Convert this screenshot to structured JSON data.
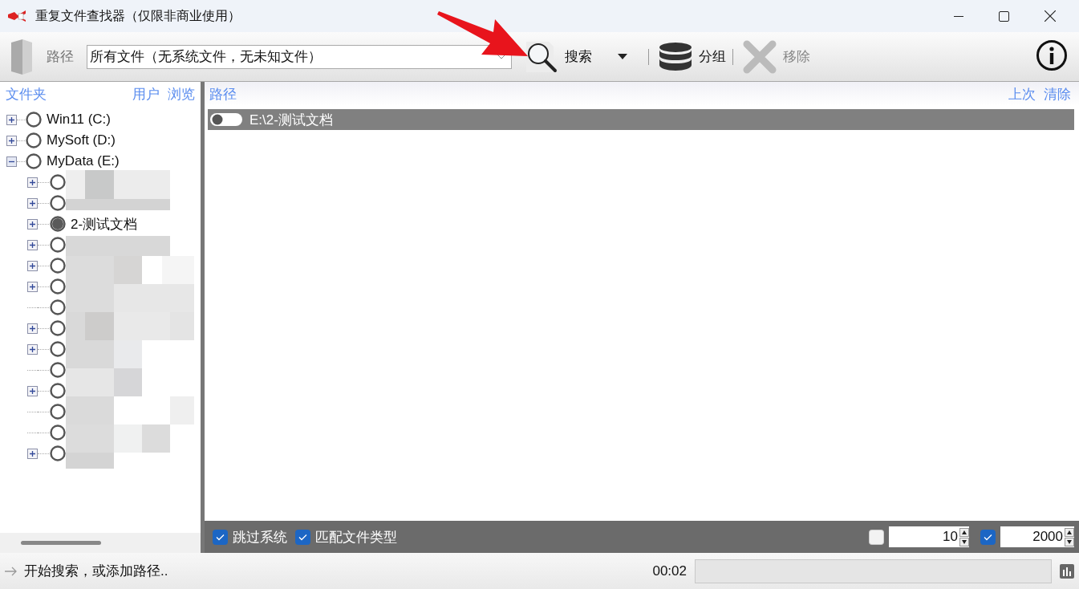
{
  "window": {
    "title": "重复文件查找器（仅限非商业使用）"
  },
  "toolbar": {
    "path_label": "路径",
    "filter": {
      "value": "所有文件（无系统文件，无未知文件）"
    },
    "buttons": [
      {
        "kind": "search",
        "label": "搜索",
        "disabled": false
      },
      {
        "kind": "group",
        "label": "分组",
        "disabled": false
      },
      {
        "kind": "remove",
        "label": "移除",
        "disabled": true
      }
    ]
  },
  "folder_pane": {
    "title": "文件夹",
    "links": [
      "用户",
      "浏览"
    ],
    "tree": [
      {
        "label": "Win11 (C:)",
        "selected": false,
        "expandable": true,
        "expanded": false
      },
      {
        "label": "MySoft (D:)",
        "selected": false,
        "expandable": true,
        "expanded": false
      },
      {
        "label": "MyData (E:)",
        "selected": false,
        "expandable": true,
        "expanded": true,
        "children": [
          {
            "selected": false,
            "expandable": true,
            "expanded": false
          },
          {
            "selected": false,
            "expandable": true,
            "expanded": false
          },
          {
            "label": "2-测试文档",
            "selected": true,
            "expandable": true,
            "expanded": false
          },
          {
            "selected": false,
            "expandable": true,
            "expanded": false
          },
          {
            "selected": false,
            "expandable": true,
            "expanded": false
          },
          {
            "selected": false,
            "expandable": true,
            "expanded": false
          },
          {
            "selected": false,
            "expandable": false
          },
          {
            "selected": false,
            "expandable": true,
            "expanded": false
          },
          {
            "selected": false,
            "expandable": true,
            "expanded": false
          },
          {
            "selected": false,
            "expandable": false
          },
          {
            "selected": false,
            "expandable": true,
            "expanded": false
          },
          {
            "selected": false,
            "expandable": false
          },
          {
            "selected": false,
            "expandable": false
          },
          {
            "selected": false,
            "expandable": true,
            "expanded": false
          }
        ]
      }
    ]
  },
  "path_pane": {
    "title": "路径",
    "links": [
      "上次",
      "清除"
    ],
    "paths": [
      {
        "path": "E:\\2-测试文档",
        "on": false,
        "selected": true
      }
    ]
  },
  "options": {
    "checkboxes": [
      {
        "label": "跳过系统",
        "checked": true
      },
      {
        "label": "匹配文件类型",
        "checked": true
      }
    ],
    "spinners": [
      {
        "checked": false,
        "value": "10"
      },
      {
        "checked": true,
        "value": "2000"
      }
    ]
  },
  "status_bar": {
    "message": "开始搜索，或添加路径..",
    "time": "00:02",
    "progress": {
      "level": 0
    }
  }
}
